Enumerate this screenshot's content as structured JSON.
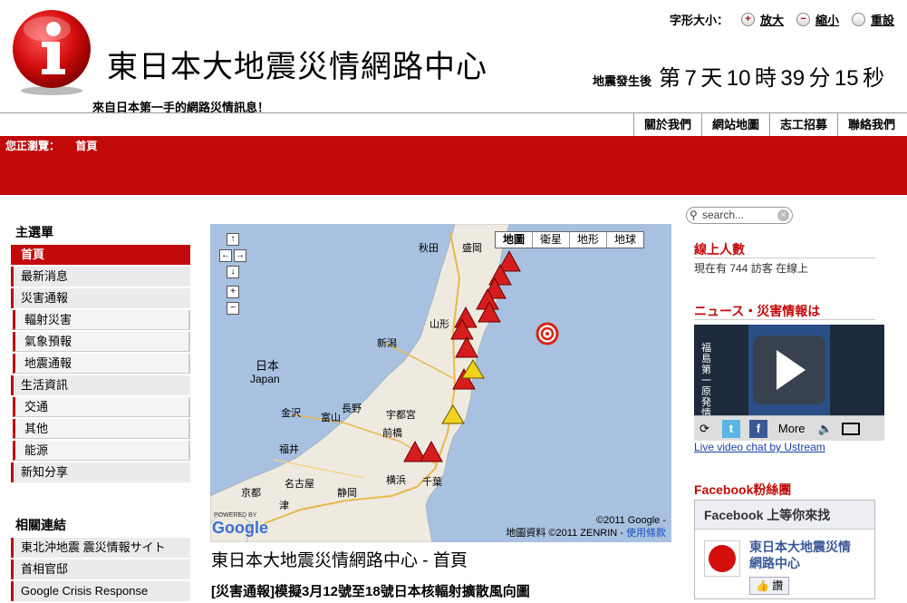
{
  "header": {
    "site_title": "東日本大地震災情網路中心",
    "tagline": "來自日本第一手的網路災情訊息！",
    "font_size": {
      "label": "字形大小：",
      "enlarge": "放大",
      "shrink": "縮小",
      "reset": "重設"
    },
    "countdown": {
      "prefix": "地震發生後",
      "d1": "第",
      "days": "7",
      "d2": "天",
      "hours": "10",
      "h": "時",
      "minutes": "39",
      "m": "分",
      "seconds": "15",
      "s": "秒"
    }
  },
  "topnav": [
    "關於我們",
    "網站地圖",
    "志工招募",
    "聯絡我們"
  ],
  "breadcrumb": {
    "label": "您正瀏覽：",
    "current": "首頁"
  },
  "sidebar": {
    "main_menu_title": "主選單",
    "menu": [
      {
        "label": "首頁"
      },
      {
        "label": "最新消息"
      },
      {
        "label": "災害通報"
      },
      {
        "label": "輻射災害"
      },
      {
        "label": "氣象預報"
      },
      {
        "label": "地震通報"
      },
      {
        "label": "生活資訊"
      },
      {
        "label": "交通"
      },
      {
        "label": "其他"
      },
      {
        "label": "能源"
      },
      {
        "label": "新知分享"
      }
    ],
    "links_title": "相關連結",
    "links": [
      {
        "label": "東北沖地震 震災情報サイト"
      },
      {
        "label": "首相官邸"
      },
      {
        "label": "Google Crisis Response"
      }
    ]
  },
  "map": {
    "types": [
      "地圖",
      "衛星",
      "地形",
      "地球"
    ],
    "pan": {
      "up": "↑",
      "left": "←",
      "right": "→",
      "down": "↓",
      "zoom_in": "+",
      "zoom_out": "−"
    },
    "places": {
      "akita": "秋田",
      "morioka": "盛岡",
      "yamagata": "山形",
      "niigata": "新潟",
      "nihon": "日本",
      "japan": "Japan",
      "nagano": "長野",
      "toyama": "富山",
      "kanazawa": "金沢",
      "utsunomiya": "宇都宮",
      "maebashi": "前橋",
      "fukui": "福井",
      "nagoya": "名古屋",
      "shizuoka": "静岡",
      "yokohama": "横浜",
      "chiba": "千葉",
      "kyoto": "京都",
      "tsu": "津"
    },
    "powered_by": "POWERED BY",
    "google_logo": "Google",
    "copyright_line1": "©2011 Google -",
    "copyright_line2": "地圖資料 ©2011 ZENRIN -",
    "terms_link": "使用條款"
  },
  "main": {
    "page_title": "東日本大地震災情網路中心 - 首頁",
    "post_title": "[災害通報]模擬3月12號至18號日本核輻射擴散風向圖"
  },
  "right": {
    "search_placeholder": "search...",
    "online_title": "線上人數",
    "online_text": "現在有 744 訪客 在線上",
    "news_title": "ニュース・災害情報は",
    "video_caption": "福島第一原発情報",
    "more_label": "More",
    "ustream_link": "Live video chat by Ustream",
    "facebook_title": "Facebook粉絲團",
    "facebook_box_header": "Facebook 上等你來找",
    "facebook_page_name": "東日本大地震災情網路中心",
    "like_label": "讚"
  },
  "colors": {
    "brand_red": "#c20a0a",
    "map_sea": "#a8c1e0",
    "link_blue": "#1a4fbf"
  }
}
